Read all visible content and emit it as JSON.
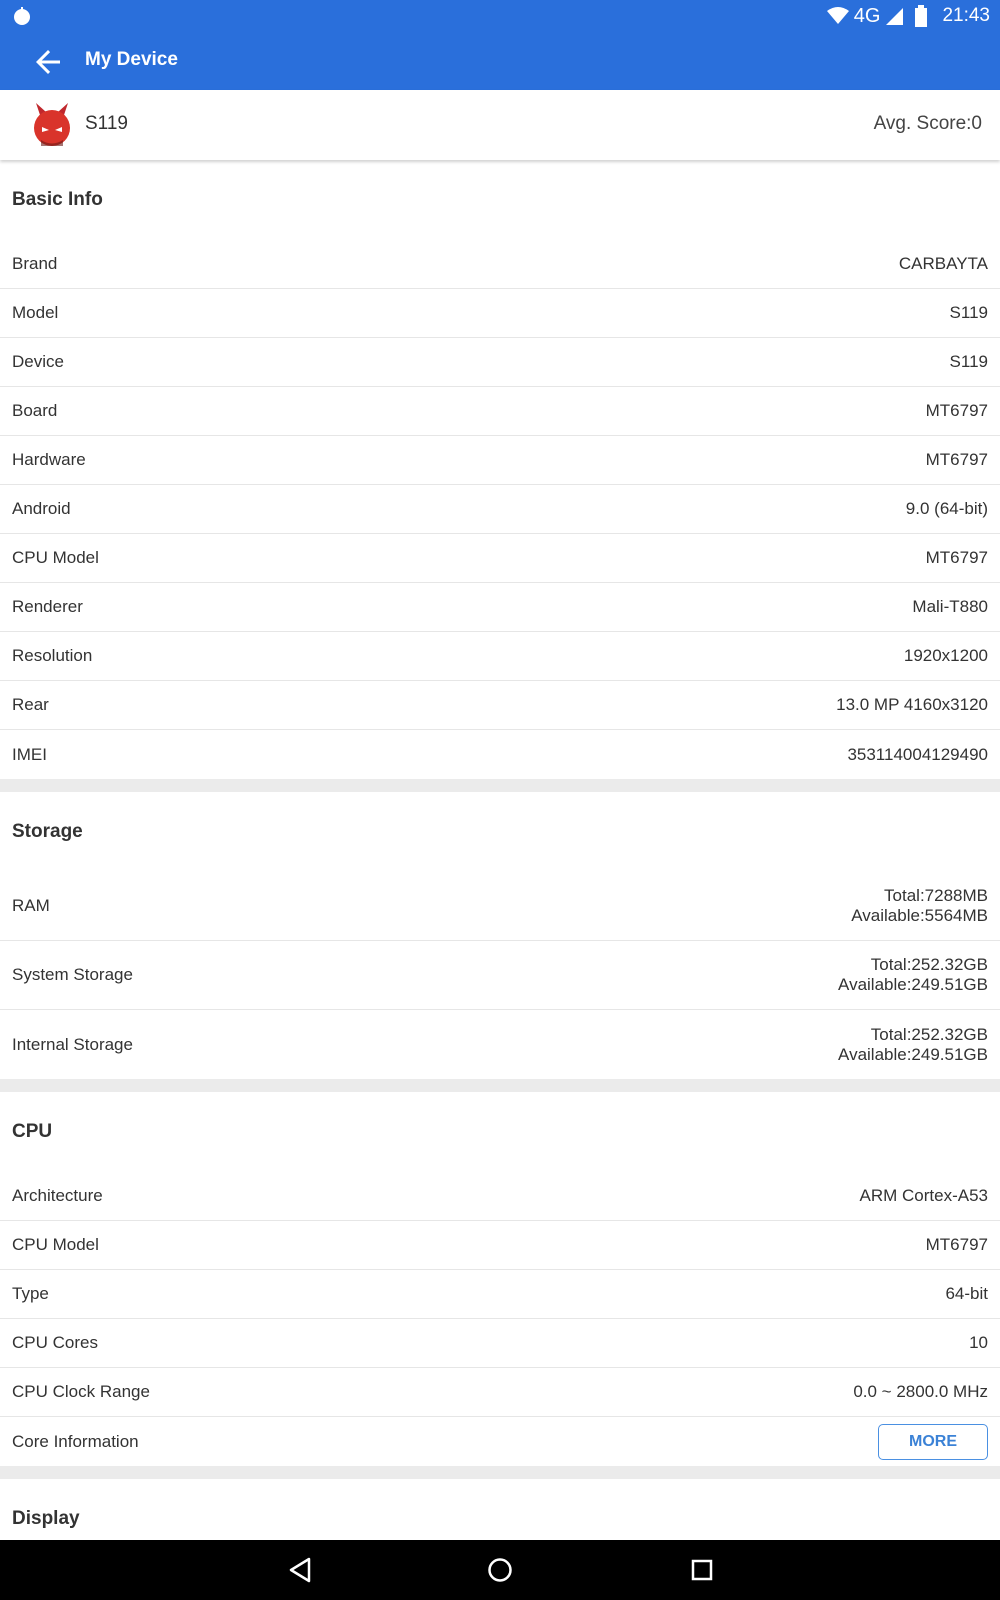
{
  "status_bar": {
    "network": "4G",
    "time": "21:43"
  },
  "toolbar": {
    "title": "My Device"
  },
  "device": {
    "name": "S119",
    "avg_score": "Avg. Score:0"
  },
  "basic_info": {
    "title": "Basic Info",
    "rows": [
      {
        "label": "Brand",
        "value": "CARBAYTA"
      },
      {
        "label": "Model",
        "value": "S119"
      },
      {
        "label": "Device",
        "value": "S119"
      },
      {
        "label": "Board",
        "value": "MT6797"
      },
      {
        "label": "Hardware",
        "value": "MT6797"
      },
      {
        "label": "Android",
        "value": "9.0 (64-bit)"
      },
      {
        "label": "CPU Model",
        "value": "MT6797"
      },
      {
        "label": "Renderer",
        "value": "Mali-T880"
      },
      {
        "label": "Resolution",
        "value": "1920x1200"
      },
      {
        "label": "Rear",
        "value": "13.0 MP 4160x3120"
      },
      {
        "label": "IMEI",
        "value": "353114004129490"
      }
    ]
  },
  "storage": {
    "title": "Storage",
    "rows": [
      {
        "label": "RAM",
        "total": "Total:7288MB",
        "available": "Available:5564MB"
      },
      {
        "label": "System Storage",
        "total": "Total:252.32GB",
        "available": "Available:249.51GB"
      },
      {
        "label": "Internal Storage",
        "total": "Total:252.32GB",
        "available": "Available:249.51GB"
      }
    ]
  },
  "cpu": {
    "title": "CPU",
    "rows": [
      {
        "label": "Architecture",
        "value": "ARM Cortex-A53"
      },
      {
        "label": "CPU Model",
        "value": "MT6797"
      },
      {
        "label": "Type",
        "value": "64-bit"
      },
      {
        "label": "CPU Cores",
        "value": "10"
      },
      {
        "label": "CPU Clock Range",
        "value": "0.0 ~ 2800.0 MHz"
      }
    ],
    "core_info": {
      "label": "Core Information",
      "button": "MORE"
    }
  },
  "display": {
    "title": "Display"
  },
  "colors": {
    "primary": "#2a6fdb",
    "divider": "#ebebeb",
    "accent": "#4a90e2"
  },
  "icons": [
    "notification-icon",
    "wifi-icon",
    "signal-icon",
    "battery-icon",
    "back-arrow-icon",
    "antutu-logo-icon",
    "nav-back-icon",
    "nav-home-icon",
    "nav-recents-icon"
  ]
}
